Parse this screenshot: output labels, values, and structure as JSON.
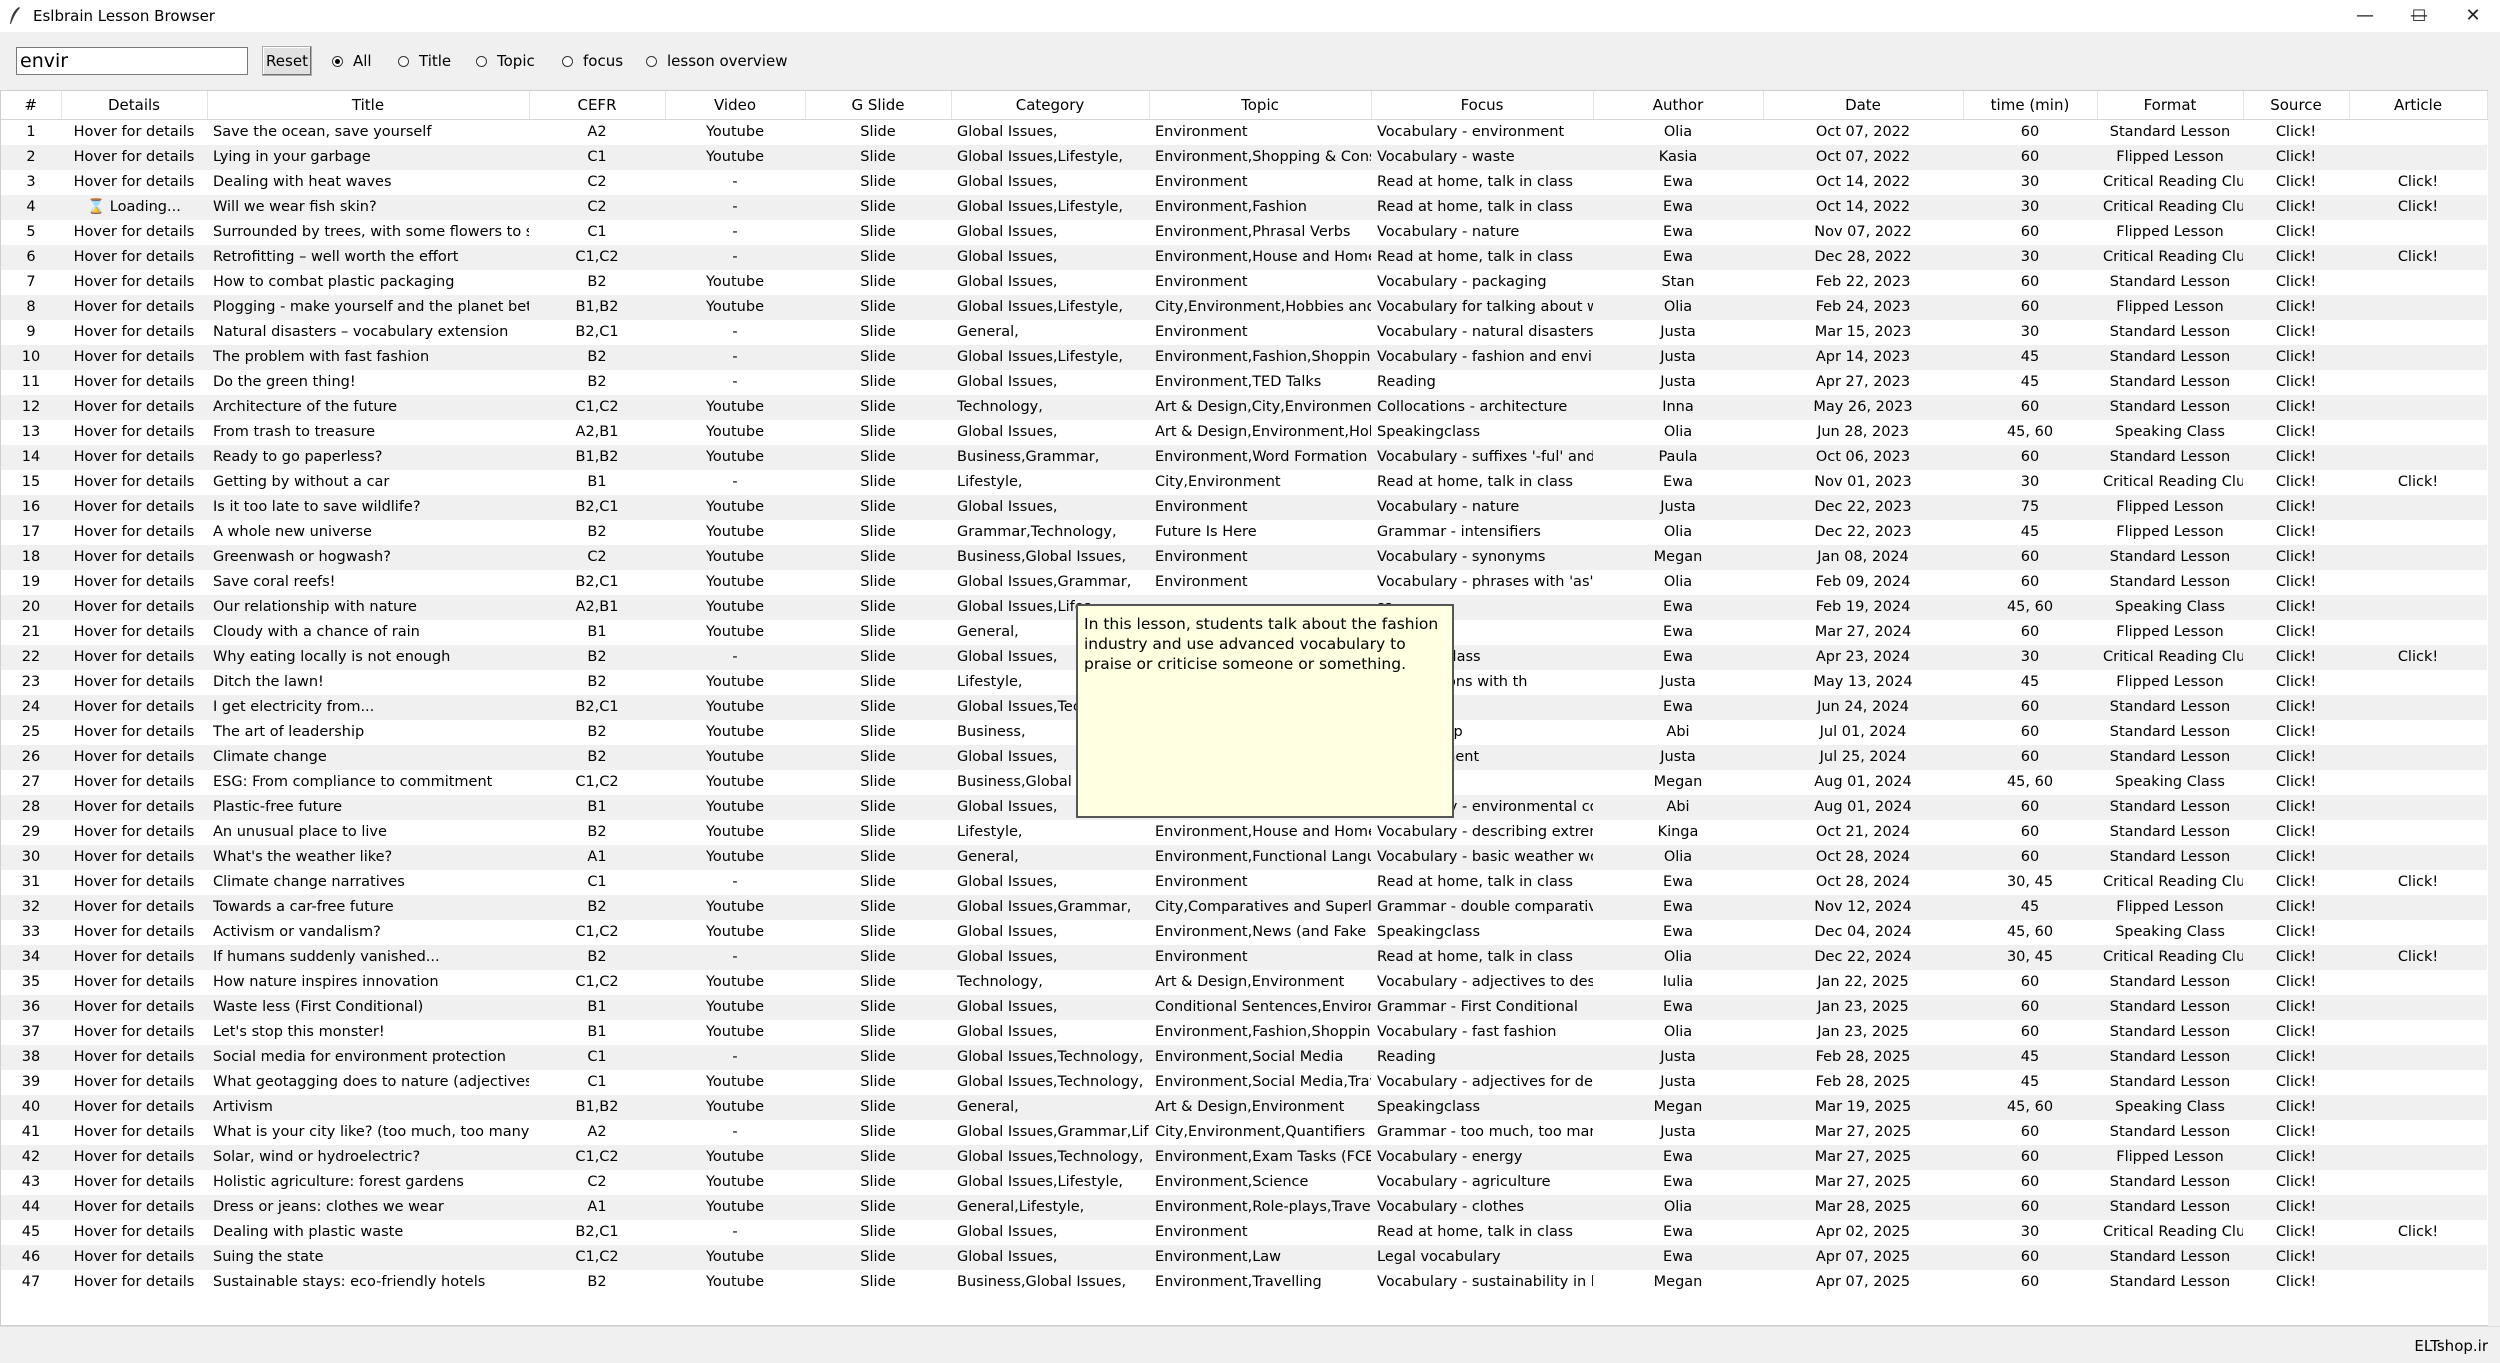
{
  "window": {
    "title": "Eslbrain Lesson Browser",
    "controls": [
      "—",
      "☐",
      "✕"
    ]
  },
  "toolbar": {
    "search_value": "envir",
    "reset_label": "Reset",
    "radios": [
      {
        "label": "All",
        "checked": true
      },
      {
        "label": "Title",
        "checked": false
      },
      {
        "label": "Topic",
        "checked": false
      },
      {
        "label": "focus",
        "checked": false
      },
      {
        "label": "lesson overview",
        "checked": false
      }
    ]
  },
  "table": {
    "columns": [
      "#",
      "Details",
      "Title",
      "CEFR",
      "Video",
      "G Slide",
      "Category",
      "Topic",
      "Focus",
      "Author",
      "Date",
      "time (min)",
      "Format",
      "Source",
      "Article"
    ],
    "rows": [
      [
        "1",
        "Hover for details",
        "Save the ocean, save yourself",
        "A2",
        "Youtube",
        "Slide",
        "Global Issues,",
        "Environment",
        "Vocabulary - environment",
        "Olia",
        "Oct 07, 2022",
        "60",
        "Standard Lesson",
        "Click!",
        ""
      ],
      [
        "2",
        "Hover for details",
        "Lying in your garbage",
        "C1",
        "Youtube",
        "Slide",
        "Global Issues,Lifestyle,",
        "Environment,Shopping & Consu",
        "Vocabulary - waste",
        "Kasia",
        "Oct 07, 2022",
        "60",
        "Flipped Lesson",
        "Click!",
        ""
      ],
      [
        "3",
        "Hover for details",
        "Dealing with heat waves",
        "C2",
        "-",
        "Slide",
        "Global Issues,",
        "Environment",
        "Read at home, talk in class",
        "Ewa",
        "Oct 14, 2022",
        "30",
        "Critical Reading Clul",
        "Click!",
        "Click!"
      ],
      [
        "4",
        "⌛ Loading...",
        "Will we wear fish skin?",
        "C2",
        "-",
        "Slide",
        "Global Issues,Lifestyle,",
        "Environment,Fashion",
        "Read at home, talk in class",
        "Ewa",
        "Oct 14, 2022",
        "30",
        "Critical Reading Clul",
        "Click!",
        "Click!"
      ],
      [
        "5",
        "Hover for details",
        "Surrounded by trees, with some flowers to sme",
        "C1",
        "-",
        "Slide",
        "Global Issues,",
        "Environment,Phrasal Verbs",
        "Vocabulary - nature",
        "Ewa",
        "Nov 07, 2022",
        "60",
        "Flipped Lesson",
        "Click!",
        ""
      ],
      [
        "6",
        "Hover for details",
        "Retrofitting – well worth the effort",
        "C1,C2",
        "-",
        "Slide",
        "Global Issues,",
        "Environment,House and Home",
        "Read at home, talk in class",
        "Ewa",
        "Dec 28, 2022",
        "30",
        "Critical Reading Clul",
        "Click!",
        "Click!"
      ],
      [
        "7",
        "Hover for details",
        "How to combat plastic packaging",
        "B2",
        "Youtube",
        "Slide",
        "Global Issues,",
        "Environment",
        "Vocabulary - packaging",
        "Stan",
        "Feb 22, 2023",
        "60",
        "Standard Lesson",
        "Click!",
        ""
      ],
      [
        "8",
        "Hover for details",
        "Plogging - make yourself and the planet better",
        "B1,B2",
        "Youtube",
        "Slide",
        "Global Issues,Lifestyle,",
        "City,Environment,Hobbies and I",
        "Vocabulary for talking about wa",
        "Olia",
        "Feb 24, 2023",
        "60",
        "Flipped Lesson",
        "Click!",
        ""
      ],
      [
        "9",
        "Hover for details",
        "Natural disasters – vocabulary extension",
        "B2,C1",
        "-",
        "Slide",
        "General,",
        "Environment",
        "Vocabulary - natural disasters",
        "Justa",
        "Mar 15, 2023",
        "30",
        "Standard Lesson",
        "Click!",
        ""
      ],
      [
        "10",
        "Hover for details",
        "The problem with fast fashion",
        "B2",
        "-",
        "Slide",
        "Global Issues,Lifestyle,",
        "Environment,Fashion,Shopping",
        "Vocabulary - fashion and enviro",
        "Justa",
        "Apr 14, 2023",
        "45",
        "Standard Lesson",
        "Click!",
        ""
      ],
      [
        "11",
        "Hover for details",
        "Do the green thing!",
        "B2",
        "-",
        "Slide",
        "Global Issues,",
        "Environment,TED Talks",
        "Reading",
        "Justa",
        "Apr 27, 2023",
        "45",
        "Standard Lesson",
        "Click!",
        ""
      ],
      [
        "12",
        "Hover for details",
        "Architecture of the future",
        "C1,C2",
        "Youtube",
        "Slide",
        "Technology,",
        "Art & Design,City,Environment",
        "Collocations - architecture",
        "Inna",
        "May 26, 2023",
        "60",
        "Standard Lesson",
        "Click!",
        ""
      ],
      [
        "13",
        "Hover for details",
        "From trash to treasure",
        "A2,B1",
        "Youtube",
        "Slide",
        "Global Issues,",
        "Art & Design,Environment,Hobl",
        "Speakingclass",
        "Olia",
        "Jun 28, 2023",
        "45, 60",
        "Speaking Class",
        "Click!",
        ""
      ],
      [
        "14",
        "Hover for details",
        "Ready to go paperless?",
        "B1,B2",
        "Youtube",
        "Slide",
        "Business,Grammar,",
        "Environment,Word Formation",
        "Vocabulary - suffixes '-ful' and '",
        "Paula",
        "Oct 06, 2023",
        "60",
        "Standard Lesson",
        "Click!",
        ""
      ],
      [
        "15",
        "Hover for details",
        "Getting by without a car",
        "B1",
        "-",
        "Slide",
        "Lifestyle,",
        "City,Environment",
        "Read at home, talk in class",
        "Ewa",
        "Nov 01, 2023",
        "30",
        "Critical Reading Clul",
        "Click!",
        "Click!"
      ],
      [
        "16",
        "Hover for details",
        "Is it too late to save wildlife?",
        "B2,C1",
        "Youtube",
        "Slide",
        "Global Issues,",
        "Environment",
        "Vocabulary - nature",
        "Justa",
        "Dec 22, 2023",
        "75",
        "Flipped Lesson",
        "Click!",
        ""
      ],
      [
        "17",
        "Hover for details",
        "A whole new universe",
        "B2",
        "Youtube",
        "Slide",
        "Grammar,Technology,",
        "Future Is Here",
        "Grammar - intensifiers",
        "Olia",
        "Dec 22, 2023",
        "45",
        "Flipped Lesson",
        "Click!",
        ""
      ],
      [
        "18",
        "Hover for details",
        "Greenwash or hogwash?",
        "C2",
        "Youtube",
        "Slide",
        "Business,Global Issues,",
        "Environment",
        "Vocabulary - synonyms",
        "Megan",
        "Jan 08, 2024",
        "60",
        "Standard Lesson",
        "Click!",
        ""
      ],
      [
        "19",
        "Hover for details",
        "Save coral reefs!",
        "B2,C1",
        "Youtube",
        "Slide",
        "Global Issues,Grammar,",
        "Environment",
        "Vocabulary - phrases with 'as'",
        "Olia",
        "Feb 09, 2024",
        "60",
        "Standard Lesson",
        "Click!",
        ""
      ],
      [
        "20",
        "Hover for details",
        "Our relationship with nature",
        "A2,B1",
        "Youtube",
        "Slide",
        "Global Issues,Lifes",
        "",
        "ss",
        "Ewa",
        "Feb 19, 2024",
        "45, 60",
        "Speaking Class",
        "Click!",
        ""
      ],
      [
        "21",
        "Hover for details",
        "Cloudy with a chance of rain",
        "B1",
        "Youtube",
        "Slide",
        "General,",
        "",
        "- weather",
        "Ewa",
        "Mar 27, 2024",
        "60",
        "Flipped Lesson",
        "Click!",
        ""
      ],
      [
        "22",
        "Hover for details",
        "Why eating locally is not enough",
        "B2",
        "-",
        "Slide",
        "Global Issues,",
        "",
        "e, talk in class",
        "Ewa",
        "Apr 23, 2024",
        "30",
        "Critical Reading Clul",
        "Click!",
        "Click!"
      ],
      [
        "23",
        "Hover for details",
        "Ditch the lawn!",
        "B2",
        "Youtube",
        "Slide",
        "Lifestyle,",
        "",
        "- expressions with th",
        "Justa",
        "May 13, 2024",
        "45",
        "Flipped Lesson",
        "Click!",
        ""
      ],
      [
        "24",
        "Hover for details",
        "I get electricity from...",
        "B2,C1",
        "Youtube",
        "Slide",
        "Global Issues,Tec",
        "",
        "- energy",
        "Ewa",
        "Jun 24, 2024",
        "60",
        "Standard Lesson",
        "Click!",
        ""
      ],
      [
        "25",
        "Hover for details",
        "The art of leadership",
        "B2",
        "Youtube",
        "Slide",
        "Business,",
        "",
        "- leadership",
        "Abi",
        "Jul 01, 2024",
        "60",
        "Standard Lesson",
        "Click!",
        ""
      ],
      [
        "26",
        "Hover for details",
        "Climate change",
        "B2",
        "Youtube",
        "Slide",
        "Global Issues,",
        "",
        "- environment",
        "Justa",
        "Jul 25, 2024",
        "60",
        "Standard Lesson",
        "Click!",
        ""
      ],
      [
        "27",
        "Hover for details",
        "ESG: From compliance to commitment",
        "C1,C2",
        "Youtube",
        "Slide",
        "Business,Global Is",
        "",
        "ss",
        "Megan",
        "Aug 01, 2024",
        "45, 60",
        "Speaking Class",
        "Click!",
        ""
      ],
      [
        "28",
        "Hover for details",
        "Plastic-free future",
        "B1",
        "Youtube",
        "Slide",
        "Global Issues,",
        "Environment",
        "Vocabulary - environmental col",
        "Abi",
        "Aug 01, 2024",
        "60",
        "Standard Lesson",
        "Click!",
        ""
      ],
      [
        "29",
        "Hover for details",
        "An unusual place to live",
        "B2",
        "Youtube",
        "Slide",
        "Lifestyle,",
        "Environment,House and Home,",
        "Vocabulary - describing extreme",
        "Kinga",
        "Oct 21, 2024",
        "60",
        "Standard Lesson",
        "Click!",
        ""
      ],
      [
        "30",
        "Hover for details",
        "What's the weather like?",
        "A1",
        "Youtube",
        "Slide",
        "General,",
        "Environment,Functional Langua",
        "Vocabulary - basic weather wor",
        "Olia",
        "Oct 28, 2024",
        "60",
        "Standard Lesson",
        "Click!",
        ""
      ],
      [
        "31",
        "Hover for details",
        "Climate change narratives",
        "C1",
        "-",
        "Slide",
        "Global Issues,",
        "Environment",
        "Read at home, talk in class",
        "Ewa",
        "Oct 28, 2024",
        "30, 45",
        "Critical Reading Clul",
        "Click!",
        "Click!"
      ],
      [
        "32",
        "Hover for details",
        "Towards a car-free future",
        "B2",
        "Youtube",
        "Slide",
        "Global Issues,Grammar,",
        "City,Comparatives and Superlat",
        "Grammar - double comparative",
        "Ewa",
        "Nov 12, 2024",
        "45",
        "Flipped Lesson",
        "Click!",
        ""
      ],
      [
        "33",
        "Hover for details",
        "Activism or vandalism?",
        "C1,C2",
        "Youtube",
        "Slide",
        "Global Issues,",
        "Environment,News (and Fake N",
        "Speakingclass",
        "Ewa",
        "Dec 04, 2024",
        "45, 60",
        "Speaking Class",
        "Click!",
        ""
      ],
      [
        "34",
        "Hover for details",
        "If humans suddenly vanished...",
        "B2",
        "-",
        "Slide",
        "Global Issues,",
        "Environment",
        "Read at home, talk in class",
        "Olia",
        "Dec 22, 2024",
        "30, 45",
        "Critical Reading Clul",
        "Click!",
        "Click!"
      ],
      [
        "35",
        "Hover for details",
        "How nature inspires innovation",
        "C1,C2",
        "Youtube",
        "Slide",
        "Technology,",
        "Art & Design,Environment",
        "Vocabulary - adjectives to descr",
        "Iulia",
        "Jan 22, 2025",
        "60",
        "Standard Lesson",
        "Click!",
        ""
      ],
      [
        "36",
        "Hover for details",
        "Waste less (First Conditional)",
        "B1",
        "Youtube",
        "Slide",
        "Global Issues,",
        "Conditional Sentences,Environm",
        "Grammar - First Conditional",
        "Ewa",
        "Jan 23, 2025",
        "60",
        "Standard Lesson",
        "Click!",
        ""
      ],
      [
        "37",
        "Hover for details",
        "Let's stop this monster!",
        "B1",
        "Youtube",
        "Slide",
        "Global Issues,",
        "Environment,Fashion,Shopping",
        "Vocabulary - fast fashion",
        "Olia",
        "Jan 23, 2025",
        "60",
        "Standard Lesson",
        "Click!",
        ""
      ],
      [
        "38",
        "Hover for details",
        "Social media for environment protection",
        "C1",
        "-",
        "Slide",
        "Global Issues,Technology,",
        "Environment,Social Media",
        "Reading",
        "Justa",
        "Feb 28, 2025",
        "45",
        "Standard Lesson",
        "Click!",
        ""
      ],
      [
        "39",
        "Hover for details",
        "What geotagging does to nature (adjectives for",
        "C1",
        "Youtube",
        "Slide",
        "Global Issues,Technology,",
        "Environment,Social Media,Trave",
        "Vocabulary - adjectives for desc",
        "Justa",
        "Feb 28, 2025",
        "45",
        "Standard Lesson",
        "Click!",
        ""
      ],
      [
        "40",
        "Hover for details",
        "Artivism",
        "B1,B2",
        "Youtube",
        "Slide",
        "General,",
        "Art & Design,Environment",
        "Speakingclass",
        "Megan",
        "Mar 19, 2025",
        "45, 60",
        "Speaking Class",
        "Click!",
        ""
      ],
      [
        "41",
        "Hover for details",
        "What is your city like? (too much, too many, er",
        "A2",
        "-",
        "Slide",
        "Global Issues,Grammar,Lifes",
        "City,Environment,Quantifiers",
        "Grammar - too much, too many",
        "Justa",
        "Mar 27, 2025",
        "60",
        "Standard Lesson",
        "Click!",
        ""
      ],
      [
        "42",
        "Hover for details",
        "Solar, wind or hydroelectric?",
        "C1,C2",
        "Youtube",
        "Slide",
        "Global Issues,Technology,",
        "Environment,Exam Tasks (FCE/C",
        "Vocabulary - energy",
        "Ewa",
        "Mar 27, 2025",
        "60",
        "Flipped Lesson",
        "Click!",
        ""
      ],
      [
        "43",
        "Hover for details",
        "Holistic agriculture: forest gardens",
        "C2",
        "Youtube",
        "Slide",
        "Global Issues,Lifestyle,",
        "Environment,Science",
        "Vocabulary - agriculture",
        "Ewa",
        "Mar 27, 2025",
        "60",
        "Standard Lesson",
        "Click!",
        ""
      ],
      [
        "44",
        "Hover for details",
        "Dress or jeans: clothes we wear",
        "A1",
        "Youtube",
        "Slide",
        "General,Lifestyle,",
        "Environment,Role-plays,Travelli",
        "Vocabulary - clothes",
        "Olia",
        "Mar 28, 2025",
        "60",
        "Standard Lesson",
        "Click!",
        ""
      ],
      [
        "45",
        "Hover for details",
        "Dealing with plastic waste",
        "B2,C1",
        "-",
        "Slide",
        "Global Issues,",
        "Environment",
        "Read at home, talk in class",
        "Ewa",
        "Apr 02, 2025",
        "30",
        "Critical Reading Clul",
        "Click!",
        "Click!"
      ],
      [
        "46",
        "Hover for details",
        "Suing the state",
        "C1,C2",
        "Youtube",
        "Slide",
        "Global Issues,",
        "Environment,Law",
        "Legal vocabulary",
        "Ewa",
        "Apr 07, 2025",
        "60",
        "Standard Lesson",
        "Click!",
        ""
      ],
      [
        "47",
        "Hover for details",
        "Sustainable stays: eco-friendly hotels",
        "B2",
        "Youtube",
        "Slide",
        "Business,Global Issues,",
        "Environment,Travelling",
        "Vocabulary - sustainability in hc",
        "Megan",
        "Apr 07, 2025",
        "60",
        "Standard Lesson",
        "Click!",
        ""
      ]
    ]
  },
  "tooltip": {
    "text": "In this lesson, students talk about the fashion industry and use advanced vocabulary to praise or criticise someone or something."
  },
  "statusbar": {
    "text": "ELTshop.ir"
  }
}
